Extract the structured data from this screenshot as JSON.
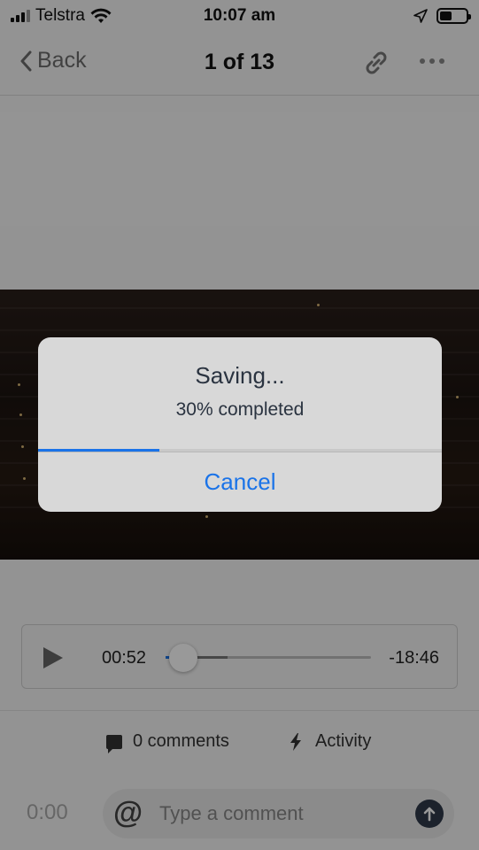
{
  "status_bar": {
    "carrier": "Telstra",
    "time": "10:07 am",
    "battery_level": 0.45
  },
  "nav": {
    "back_label": "Back",
    "title": "1 of 13"
  },
  "player": {
    "elapsed": "00:52",
    "remaining": "-18:46"
  },
  "meta": {
    "comments_label": "0 comments",
    "activity_label": "Activity"
  },
  "composer": {
    "time": "0:00",
    "placeholder": "Type a comment"
  },
  "alert": {
    "title": "Saving...",
    "message": "30% completed",
    "progress": 0.3,
    "cancel_label": "Cancel"
  },
  "colors": {
    "accent": "#1a73e8",
    "overlay": "rgba(0,0,0,0.40)",
    "alert_bg": "#d8d8d8"
  }
}
